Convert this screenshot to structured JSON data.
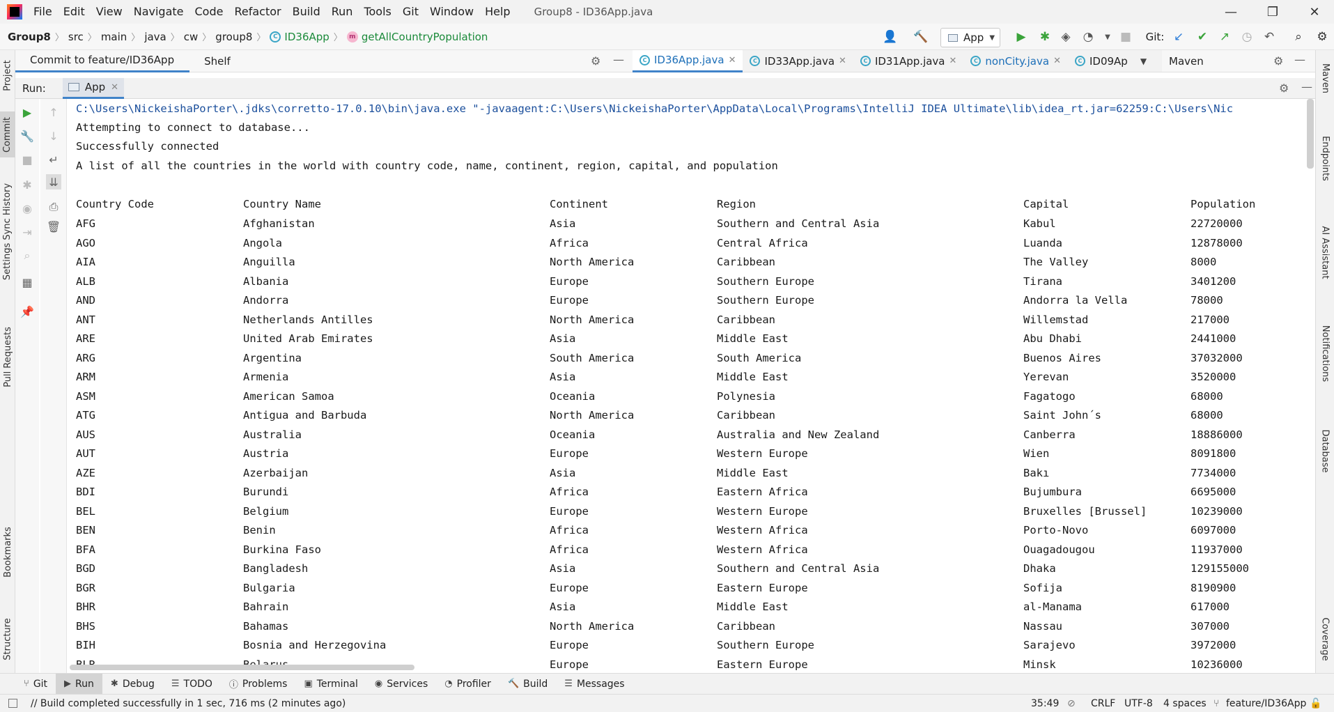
{
  "window": {
    "title": "Group8 - ID36App.java",
    "menu": [
      "File",
      "Edit",
      "View",
      "Navigate",
      "Code",
      "Refactor",
      "Build",
      "Run",
      "Tools",
      "Git",
      "Window",
      "Help"
    ],
    "controls": {
      "minimize": "—",
      "restore": "❐",
      "close": "✕"
    }
  },
  "navbar": {
    "breadcrumbs": [
      "Group8",
      "src",
      "main",
      "java",
      "cw",
      "group8",
      "ID36App",
      "getAllCountryPopulation"
    ],
    "run_config": "App",
    "git_label": "Git:"
  },
  "commit_panel": {
    "tabs": [
      "Commit to feature/ID36App",
      "Shelf"
    ]
  },
  "editor": {
    "tabs": [
      "ID36App.java",
      "ID33App.java",
      "ID31App.java",
      "nonCity.java",
      "ID09Ap"
    ],
    "active_tab": "ID36App.java"
  },
  "maven_panel": {
    "title": "Maven"
  },
  "left_strip": [
    "Project",
    "Commit",
    "Settings Sync History",
    "Pull Requests",
    "Bookmarks",
    "Structure"
  ],
  "right_strip": [
    "Maven",
    "Endpoints",
    "AI Assistant",
    "Notifications",
    "Database",
    "Coverage"
  ],
  "run_window": {
    "label": "Run:",
    "tab": "App",
    "console_lines": [
      "C:\\Users\\NickeishaPorter\\.jdks\\corretto-17.0.10\\bin\\java.exe \"-javaagent:C:\\Users\\NickeishaPorter\\AppData\\Local\\Programs\\IntelliJ IDEA Ultimate\\lib\\idea_rt.jar=62259:C:\\Users\\Nic",
      "Attempting to connect to database...",
      "Successfully connected",
      "A list of all the countries in the world with country code, name, continent, region, capital, and population"
    ],
    "table": {
      "headers": [
        "Country Code",
        "Country Name",
        "Continent",
        "Region",
        "Capital",
        "Population"
      ],
      "rows": [
        [
          "AFG",
          "Afghanistan",
          "Asia",
          "Southern and Central Asia",
          "Kabul",
          "22720000"
        ],
        [
          "AGO",
          "Angola",
          "Africa",
          "Central Africa",
          "Luanda",
          "12878000"
        ],
        [
          "AIA",
          "Anguilla",
          "North America",
          "Caribbean",
          "The Valley",
          "8000"
        ],
        [
          "ALB",
          "Albania",
          "Europe",
          "Southern Europe",
          "Tirana",
          "3401200"
        ],
        [
          "AND",
          "Andorra",
          "Europe",
          "Southern Europe",
          "Andorra la Vella",
          "78000"
        ],
        [
          "ANT",
          "Netherlands Antilles",
          "North America",
          "Caribbean",
          "Willemstad",
          "217000"
        ],
        [
          "ARE",
          "United Arab Emirates",
          "Asia",
          "Middle East",
          "Abu Dhabi",
          "2441000"
        ],
        [
          "ARG",
          "Argentina",
          "South America",
          "South America",
          "Buenos Aires",
          "37032000"
        ],
        [
          "ARM",
          "Armenia",
          "Asia",
          "Middle East",
          "Yerevan",
          "3520000"
        ],
        [
          "ASM",
          "American Samoa",
          "Oceania",
          "Polynesia",
          "Fagatogo",
          "68000"
        ],
        [
          "ATG",
          "Antigua and Barbuda",
          "North America",
          "Caribbean",
          "Saint John´s",
          "68000"
        ],
        [
          "AUS",
          "Australia",
          "Oceania",
          "Australia and New Zealand",
          "Canberra",
          "18886000"
        ],
        [
          "AUT",
          "Austria",
          "Europe",
          "Western Europe",
          "Wien",
          "8091800"
        ],
        [
          "AZE",
          "Azerbaijan",
          "Asia",
          "Middle East",
          "Bakı",
          "7734000"
        ],
        [
          "BDI",
          "Burundi",
          "Africa",
          "Eastern Africa",
          "Bujumbura",
          "6695000"
        ],
        [
          "BEL",
          "Belgium",
          "Europe",
          "Western Europe",
          "Bruxelles [Brussel]",
          "10239000"
        ],
        [
          "BEN",
          "Benin",
          "Africa",
          "Western Africa",
          "Porto-Novo",
          "6097000"
        ],
        [
          "BFA",
          "Burkina Faso",
          "Africa",
          "Western Africa",
          "Ouagadougou",
          "11937000"
        ],
        [
          "BGD",
          "Bangladesh",
          "Asia",
          "Southern and Central Asia",
          "Dhaka",
          "129155000"
        ],
        [
          "BGR",
          "Bulgaria",
          "Europe",
          "Eastern Europe",
          "Sofija",
          "8190900"
        ],
        [
          "BHR",
          "Bahrain",
          "Asia",
          "Middle East",
          "al-Manama",
          "617000"
        ],
        [
          "BHS",
          "Bahamas",
          "North America",
          "Caribbean",
          "Nassau",
          "307000"
        ],
        [
          "BIH",
          "Bosnia and Herzegovina",
          "Europe",
          "Southern Europe",
          "Sarajevo",
          "3972000"
        ],
        [
          "BLR",
          "Belarus",
          "Europe",
          "Eastern Europe",
          "Minsk",
          "10236000"
        ]
      ]
    }
  },
  "bottom_tools": [
    {
      "label": "Git",
      "icon": "git-icon"
    },
    {
      "label": "Run",
      "icon": "run-icon"
    },
    {
      "label": "Debug",
      "icon": "debug-icon"
    },
    {
      "label": "TODO",
      "icon": "todo-icon"
    },
    {
      "label": "Problems",
      "icon": "problems-icon"
    },
    {
      "label": "Terminal",
      "icon": "terminal-icon"
    },
    {
      "label": "Services",
      "icon": "services-icon"
    },
    {
      "label": "Profiler",
      "icon": "profiler-icon"
    },
    {
      "label": "Build",
      "icon": "build-icon"
    },
    {
      "label": "Messages",
      "icon": "messages-icon"
    }
  ],
  "status_bar": {
    "message": "// Build completed successfully in 1 sec, 716 ms (2 minutes ago)",
    "position": "35:49",
    "line_sep": "CRLF",
    "encoding": "UTF-8",
    "indent": "4 spaces",
    "branch": "feature/ID36App"
  }
}
